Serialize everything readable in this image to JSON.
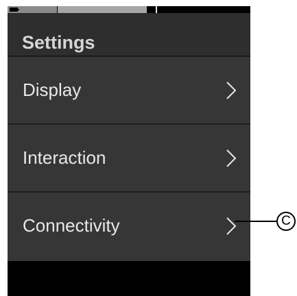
{
  "header": {
    "title": "Settings"
  },
  "menu": {
    "items": [
      {
        "label": "Display"
      },
      {
        "label": "Interaction"
      },
      {
        "label": "Connectivity"
      }
    ]
  },
  "callout": {
    "label": "C"
  },
  "icons": {
    "chevron": "chevron-right-icon",
    "battery": "battery-icon"
  },
  "colors": {
    "background": "#000000",
    "panel": "#363636",
    "header": "#2e2e2e",
    "text": "#e8e8e8"
  }
}
